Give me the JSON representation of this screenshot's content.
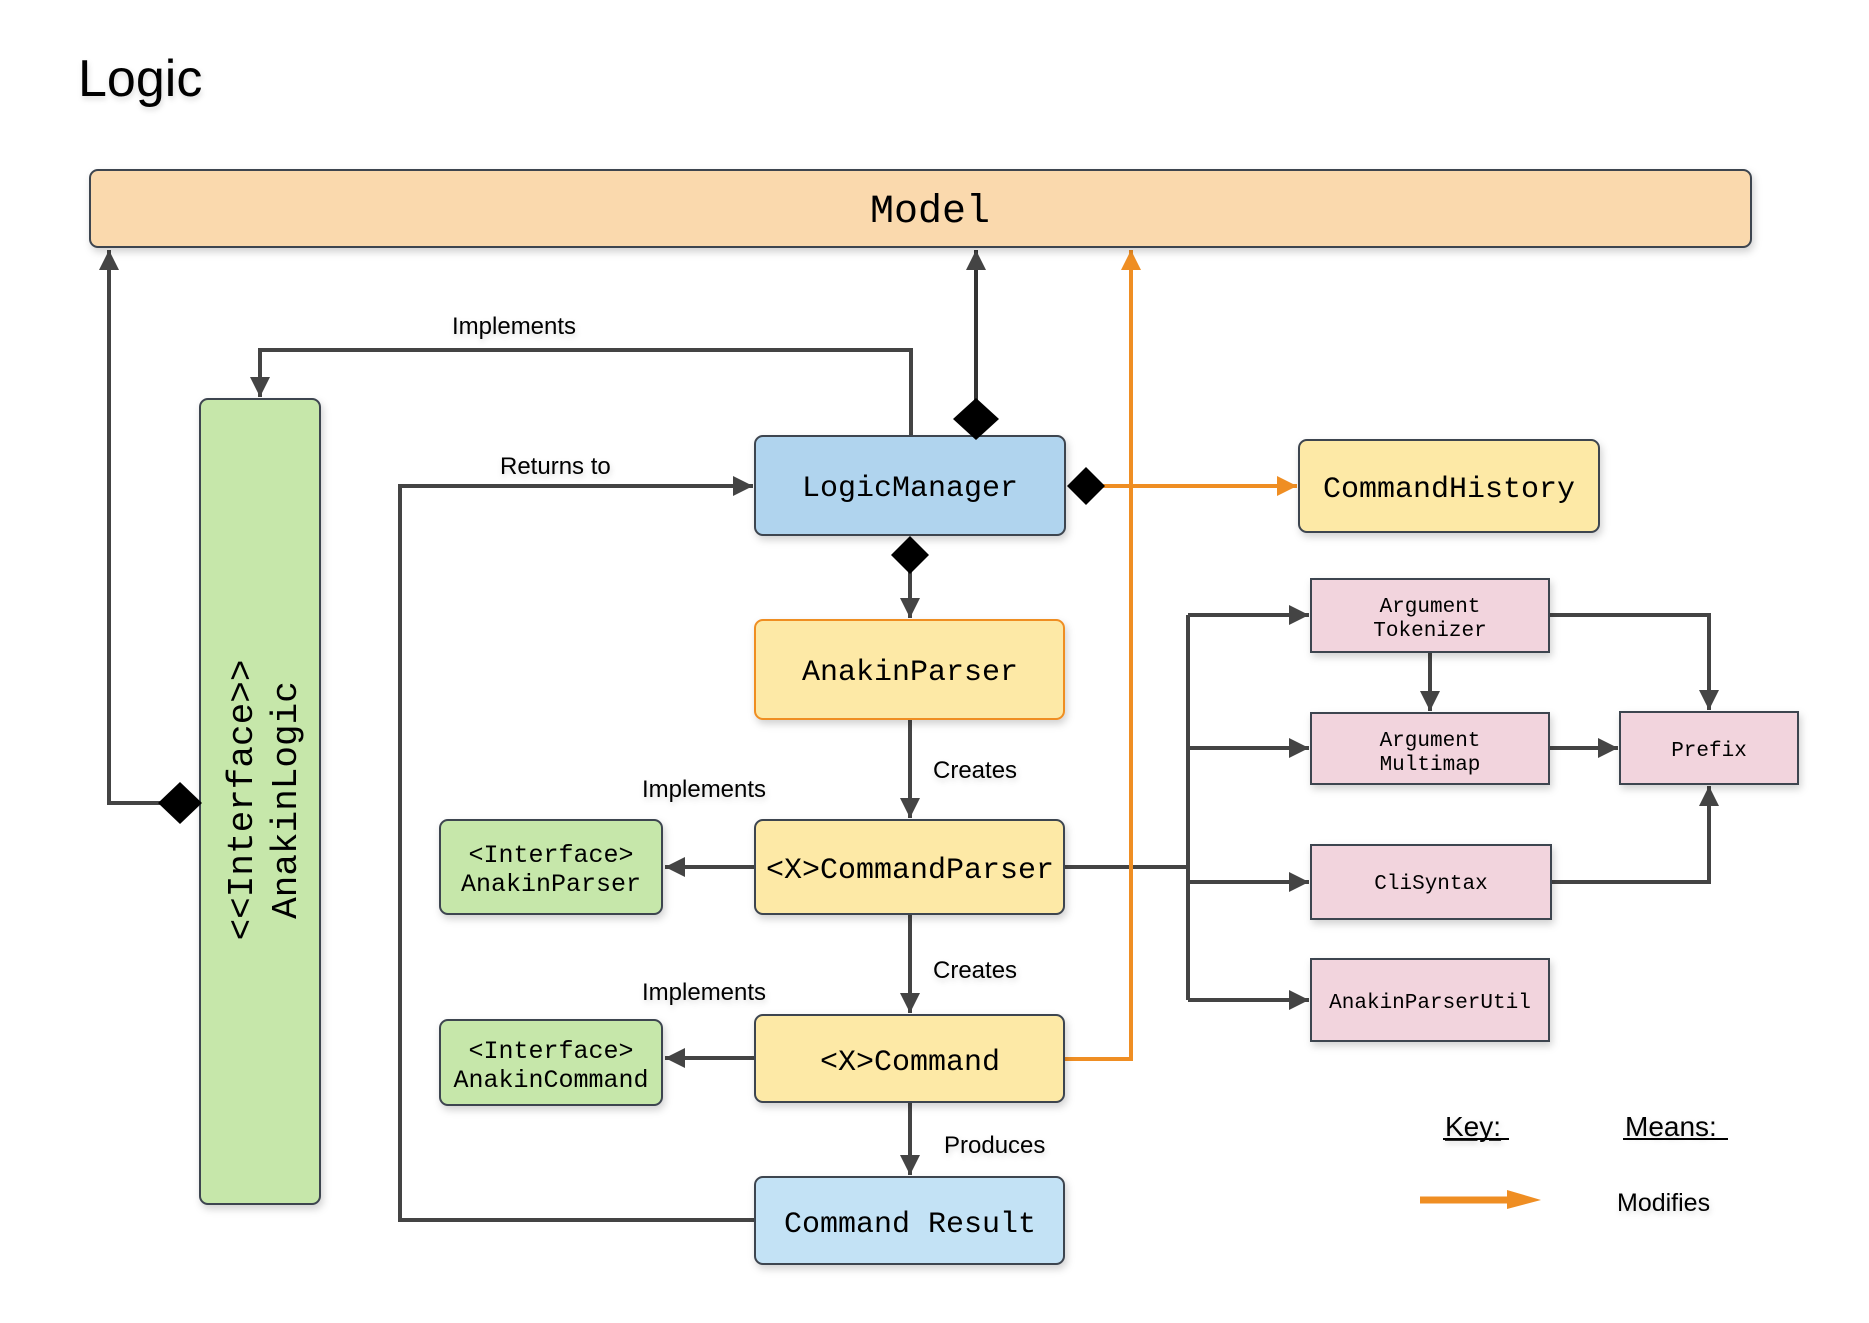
{
  "title": "Logic",
  "colors": {
    "model_fill": "#fad9ad",
    "logic_manager_fill": "#b0d4ee",
    "command_result_fill": "#c3e2f5",
    "yellow_fill": "#fde9a6",
    "anakin_parser_border": "#ef8e23",
    "interface_fill": "#c6e7aa",
    "util_fill": "#f2d4dd",
    "border": "#3d4450",
    "line": "#444444",
    "modifies": "#ef8e23",
    "diamond": "#000000"
  },
  "nodes": {
    "model": {
      "label": "Model"
    },
    "anakin_logic": {
      "line1": "<<Interface>>",
      "line2": "AnakinLogic"
    },
    "logic_manager": {
      "label": "LogicManager"
    },
    "command_history": {
      "label": "CommandHistory"
    },
    "anakin_parser": {
      "label": "AnakinParser"
    },
    "x_command_parser": {
      "label": "<X>CommandParser"
    },
    "x_command": {
      "label": "<X>Command"
    },
    "command_result": {
      "label": "Command Result"
    },
    "interface_anakin_parser": {
      "line1": "<Interface>",
      "line2": "AnakinParser"
    },
    "interface_anakin_command": {
      "line1": "<Interface>",
      "line2": "AnakinCommand"
    },
    "argument_tokenizer": {
      "line1": "Argument",
      "line2": "Tokenizer"
    },
    "argument_multimap": {
      "line1": "Argument",
      "line2": "Multimap"
    },
    "prefix": {
      "label": "Prefix"
    },
    "cli_syntax": {
      "label": "CliSyntax"
    },
    "anakin_parser_util": {
      "label": "AnakinParserUtil"
    }
  },
  "edge_labels": {
    "implements_top": "Implements",
    "returns_to": "Returns to",
    "creates_parser": "Creates",
    "implements_parser": "Implements",
    "creates_command": "Creates",
    "implements_command": "Implements",
    "produces": "Produces"
  },
  "legend": {
    "key_header": "Key:",
    "means_header": "Means:",
    "items": [
      {
        "symbol": "orange-arrow",
        "meaning": "Modifies"
      }
    ]
  }
}
